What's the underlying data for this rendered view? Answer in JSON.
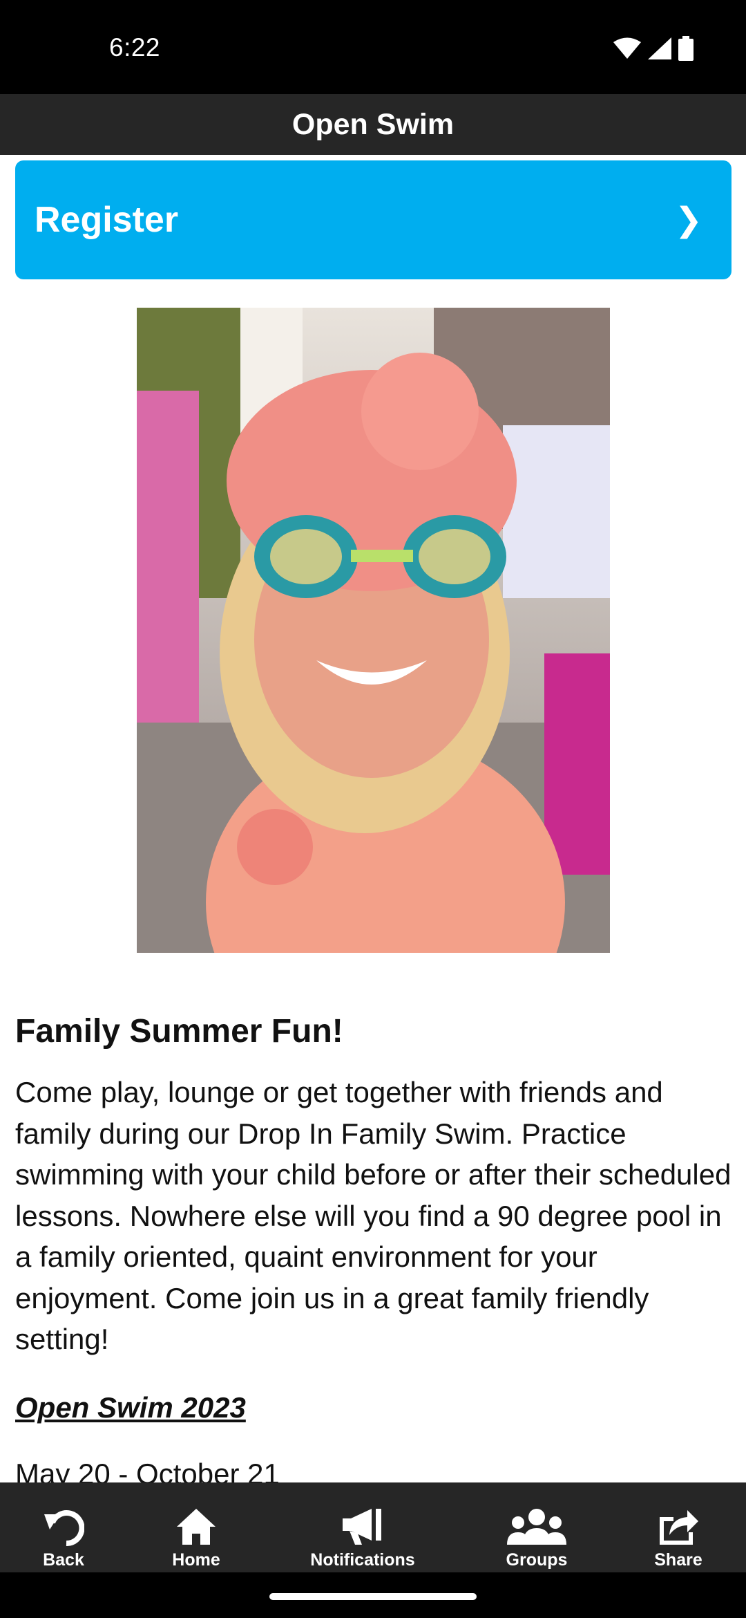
{
  "status_bar": {
    "time": "6:22",
    "icons": [
      "wifi-icon",
      "cell-signal-icon",
      "battery-icon"
    ]
  },
  "header": {
    "title": "Open Swim"
  },
  "register": {
    "label": "Register",
    "chevron": "❯",
    "color": "#00aeef"
  },
  "article": {
    "image_alt": "Child in pink swim cap and goggles",
    "heading": "Family Summer Fun!",
    "body": "Come play, lounge or get together with friends and family during our Drop In Family Swim. Practice swimming with your child before or after their scheduled lessons.  Nowhere else will you find a 90 degree pool in a family oriented, quaint environment for your enjoyment. Come join us in a great family friendly setting!",
    "subheading": "Open Swim 2023",
    "dates": "May 20 - October 21"
  },
  "tab_bar": {
    "tabs": [
      {
        "label": "Back",
        "icon": "back-arrow-icon"
      },
      {
        "label": "Home",
        "icon": "home-icon"
      },
      {
        "label": "Notifications",
        "icon": "megaphone-icon"
      },
      {
        "label": "Groups",
        "icon": "groups-icon"
      },
      {
        "label": "Share",
        "icon": "share-icon"
      }
    ]
  }
}
